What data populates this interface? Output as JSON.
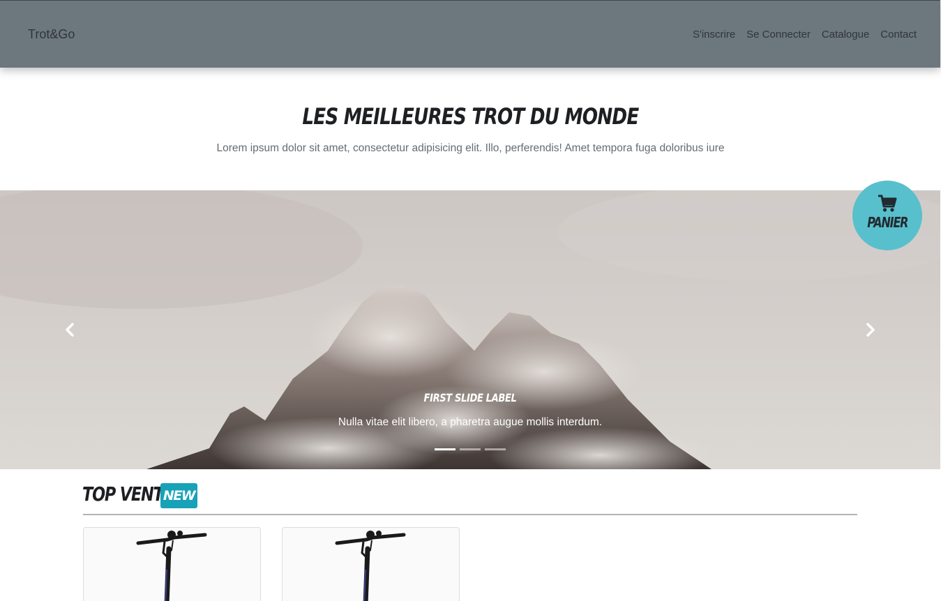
{
  "navbar": {
    "brand": "Trot&Go",
    "links": [
      "S'inscrire",
      "Se Connecter",
      "Catalogue",
      "Contact"
    ]
  },
  "hero": {
    "title": "LES MEILLEURES TROT DU MONDE",
    "subtitle": "Lorem ipsum dolor sit amet, consectetur adipisicing elit. Illo, perferendis! Amet tempora fuga doloribus iure"
  },
  "carousel": {
    "caption_title": "FIRST SLIDE LABEL",
    "caption_text": "Nulla vitae elit libero, a pharetra augue mollis interdum.",
    "slide_count": 3,
    "active_slide": 1,
    "prev_icon": "chevron-left-icon",
    "next_icon": "chevron-right-icon"
  },
  "cart": {
    "label": "PANIER",
    "icon": "shopping-cart-icon",
    "color": "#58c0cc"
  },
  "top_sales": {
    "title": "TOP VENTE",
    "badge": "NEW",
    "badge_color": "#17a2b8",
    "products": [
      {
        "image": "scooter-image"
      },
      {
        "image": "scooter-image"
      }
    ]
  },
  "colors": {
    "navbar_bg": "#6c777e"
  }
}
